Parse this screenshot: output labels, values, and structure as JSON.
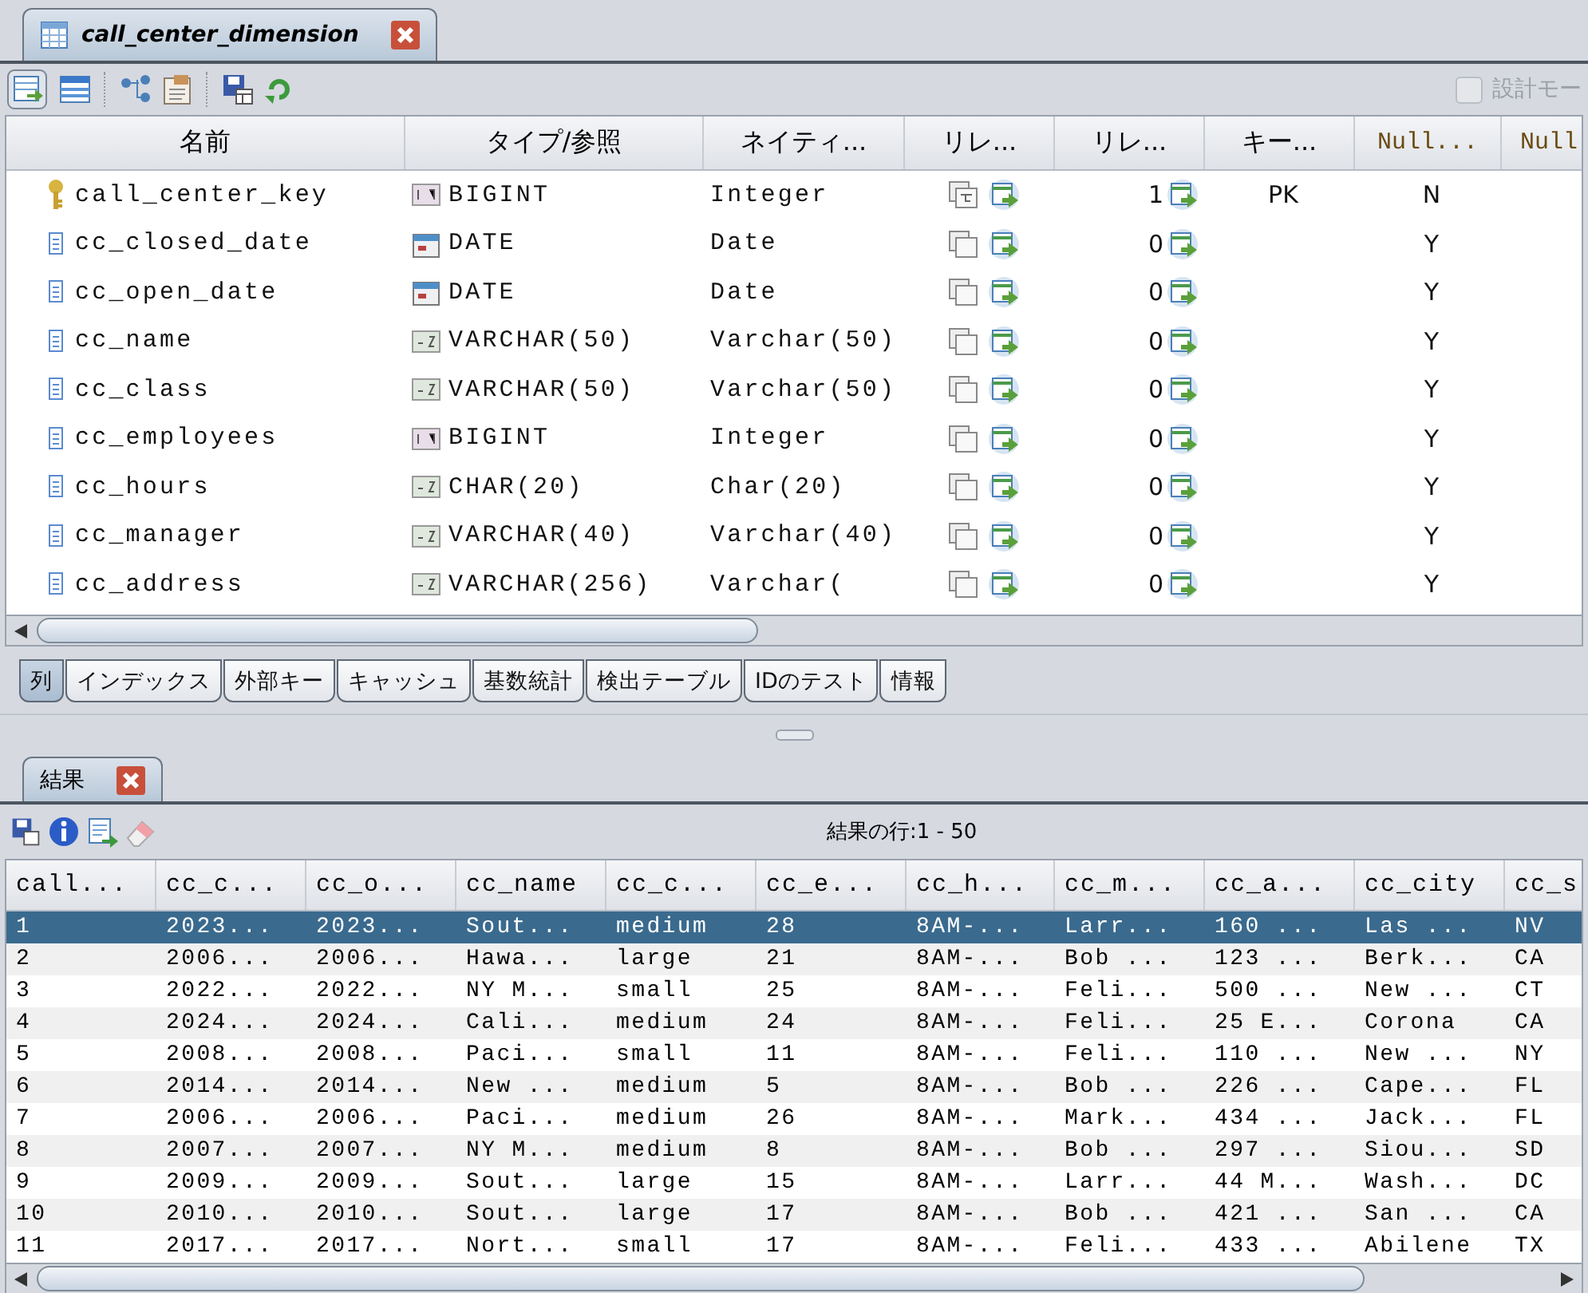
{
  "editor_tab": {
    "title": "call_center_dimension",
    "selected": true
  },
  "design_mode": {
    "label": "設計モー",
    "checked": false,
    "disabled": true
  },
  "columns_table": {
    "headers": [
      "名前",
      "タイプ/参照",
      "ネイティ...",
      "リレ...",
      "リレ...",
      "キー...",
      "Null...",
      "Null"
    ],
    "rows": [
      {
        "name": "call_center_key",
        "is_key": true,
        "type": "BIGINT",
        "kind": "number",
        "native": "Integer",
        "linked": true,
        "ref_count": "1",
        "key_label": "PK",
        "nullable": "N"
      },
      {
        "name": "cc_closed_date",
        "is_key": false,
        "type": "DATE",
        "kind": "date",
        "native": "Date",
        "linked": false,
        "ref_count": "0",
        "nullable": "Y"
      },
      {
        "name": "cc_open_date",
        "is_key": false,
        "type": "DATE",
        "kind": "date",
        "native": "Date",
        "linked": false,
        "ref_count": "0",
        "nullable": "Y"
      },
      {
        "name": "cc_name",
        "is_key": false,
        "type": "VARCHAR(50)",
        "kind": "text",
        "native": "Varchar(50)",
        "linked": false,
        "ref_count": "0",
        "nullable": "Y"
      },
      {
        "name": "cc_class",
        "is_key": false,
        "type": "VARCHAR(50)",
        "kind": "text",
        "native": "Varchar(50)",
        "linked": false,
        "ref_count": "0",
        "nullable": "Y"
      },
      {
        "name": "cc_employees",
        "is_key": false,
        "type": "BIGINT",
        "kind": "number",
        "native": "Integer",
        "linked": false,
        "ref_count": "0",
        "nullable": "Y"
      },
      {
        "name": "cc_hours",
        "is_key": false,
        "type": "CHAR(20)",
        "kind": "text",
        "native": "Char(20)",
        "linked": false,
        "ref_count": "0",
        "nullable": "Y"
      },
      {
        "name": "cc_manager",
        "is_key": false,
        "type": "VARCHAR(40)",
        "kind": "text",
        "native": "Varchar(40)",
        "linked": false,
        "ref_count": "0",
        "nullable": "Y"
      },
      {
        "name": "cc_address",
        "is_key": false,
        "type": "VARCHAR(256)",
        "kind": "text",
        "native": "Varchar(",
        "linked": false,
        "ref_count": "0",
        "nullable": "Y"
      }
    ]
  },
  "sub_tabs": [
    {
      "label": "列",
      "selected": true
    },
    {
      "label": "インデックス",
      "selected": false
    },
    {
      "label": "外部キー",
      "selected": false
    },
    {
      "label": "キャッシュ",
      "selected": false
    },
    {
      "label": "基数統計",
      "selected": false
    },
    {
      "label": "検出テーブル",
      "selected": false
    },
    {
      "label": "IDのテスト",
      "selected": false
    },
    {
      "label": "情報",
      "selected": false
    }
  ],
  "results_tab": {
    "title": "結果",
    "selected": true
  },
  "results": {
    "row_count": "結果の行:1 - 50",
    "columns": [
      "call...",
      "cc_c...",
      "cc_o...",
      "cc_name",
      "cc_c...",
      "cc_e...",
      "cc_h...",
      "cc_m...",
      "cc_a...",
      "cc_city",
      "cc_s"
    ],
    "rows": [
      {
        "selected": true,
        "cells": [
          "1",
          "2023...",
          "2023...",
          "Sout...",
          "medium",
          "28",
          "8AM-...",
          "Larr...",
          "160 ...",
          "Las ...",
          "NV"
        ]
      },
      {
        "selected": false,
        "cells": [
          "2",
          "2006...",
          "2006...",
          "Hawa...",
          "large",
          "21",
          "8AM-...",
          "Bob ...",
          "123 ...",
          "Berk...",
          "CA"
        ]
      },
      {
        "selected": false,
        "cells": [
          "3",
          "2022...",
          "2022...",
          "NY M...",
          "small",
          "25",
          "8AM-...",
          "Feli...",
          "500 ...",
          "New ...",
          "CT"
        ]
      },
      {
        "selected": false,
        "cells": [
          "4",
          "2024...",
          "2024...",
          "Cali...",
          "medium",
          "24",
          "8AM-...",
          "Feli...",
          "25 E...",
          "Corona",
          "CA"
        ]
      },
      {
        "selected": false,
        "cells": [
          "5",
          "2008...",
          "2008...",
          "Paci...",
          "small",
          "11",
          "8AM-...",
          "Feli...",
          "110 ...",
          "New ...",
          "NY"
        ]
      },
      {
        "selected": false,
        "cells": [
          "6",
          "2014...",
          "2014...",
          "New ...",
          "medium",
          "5",
          "8AM-...",
          "Bob ...",
          "226 ...",
          "Cape...",
          "FL"
        ]
      },
      {
        "selected": false,
        "cells": [
          "7",
          "2006...",
          "2006...",
          "Paci...",
          "medium",
          "26",
          "8AM-...",
          "Mark...",
          "434 ...",
          "Jack...",
          "FL"
        ]
      },
      {
        "selected": false,
        "cells": [
          "8",
          "2007...",
          "2007...",
          "NY M...",
          "medium",
          "8",
          "8AM-...",
          "Bob ...",
          "297 ...",
          "Siou...",
          "SD"
        ]
      },
      {
        "selected": false,
        "cells": [
          "9",
          "2009...",
          "2009...",
          "Sout...",
          "large",
          "15",
          "8AM-...",
          "Larr...",
          "44 M...",
          "Wash...",
          "DC"
        ]
      },
      {
        "selected": false,
        "cells": [
          "10",
          "2010...",
          "2010...",
          "Sout...",
          "large",
          "17",
          "8AM-...",
          "Bob ...",
          "421 ...",
          "San ...",
          "CA"
        ]
      },
      {
        "selected": false,
        "cells": [
          "11",
          "2017...",
          "2017...",
          "Nort...",
          "small",
          "17",
          "8AM-...",
          "Feli...",
          "433 ...",
          "Abilene",
          "TX"
        ]
      }
    ]
  }
}
